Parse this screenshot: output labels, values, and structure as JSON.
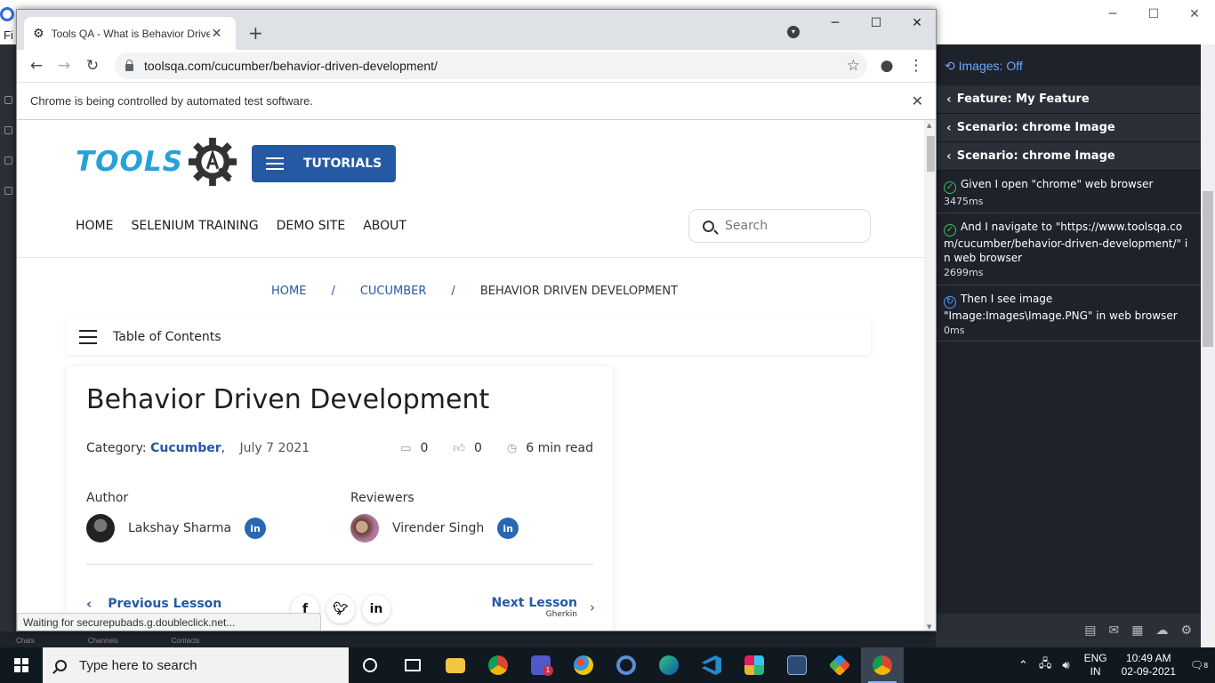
{
  "background_app": {
    "menu_letter": "Fi",
    "bottom_labels": [
      "Chats",
      "Channels",
      "Contacts"
    ]
  },
  "right_panel": {
    "images_toggle": "Images: Off",
    "headers": [
      "Feature: My Feature",
      "Scenario: chrome Image",
      "Scenario: chrome Image"
    ],
    "steps": [
      {
        "text": "Given I open \"chrome\" web browser",
        "duration": "3475ms",
        "status": "passed"
      },
      {
        "text": "And I navigate to \"https://www.toolsqa.com/cucumber/behavior-driven-development/\" in web browser",
        "duration": "2699ms",
        "status": "passed"
      },
      {
        "text": "Then I see image \"Image:Images\\Image.PNG\" in web browser",
        "duration": "0ms",
        "status": "running"
      }
    ]
  },
  "browser": {
    "tab_title": "Tools QA - What is Behavior Driven Development",
    "url": "toolsqa.com/cucumber/behavior-driven-development/",
    "infobar": "Chrome is being controlled by automated test software.",
    "status_bubble": "Waiting for securepubads.g.doubleclick.net..."
  },
  "page": {
    "logo_text": "TOOLS",
    "tutorials_label": "TUTORIALS",
    "nav": [
      "HOME",
      "SELENIUM TRAINING",
      "DEMO SITE",
      "ABOUT"
    ],
    "search_placeholder": "Search",
    "breadcrumb": {
      "home": "HOME",
      "section": "CUCUMBER",
      "current": "BEHAVIOR DRIVEN DEVELOPMENT",
      "separator": "/"
    },
    "toc_label": "Table of Contents",
    "article": {
      "title": "Behavior Driven Development",
      "category_label": "Category:",
      "category": "Cucumber",
      "category_sep": ",",
      "date": "July 7 2021",
      "comments": "0",
      "likes": "0",
      "read_time": "6 min read",
      "author_label": "Author",
      "author": "Lakshay Sharma",
      "reviewers_label": "Reviewers",
      "reviewer": "Virender Singh",
      "prev_label": "Previous Lesson",
      "next_label": "Next Lesson",
      "next_sub": "Gherkin"
    }
  },
  "taskbar": {
    "search_placeholder": "Type here to search",
    "lang_top": "ENG",
    "lang_bottom": "IN",
    "time": "10:49 AM",
    "date": "02-09-2021",
    "notification_count": "8",
    "teams_badge": "1"
  }
}
